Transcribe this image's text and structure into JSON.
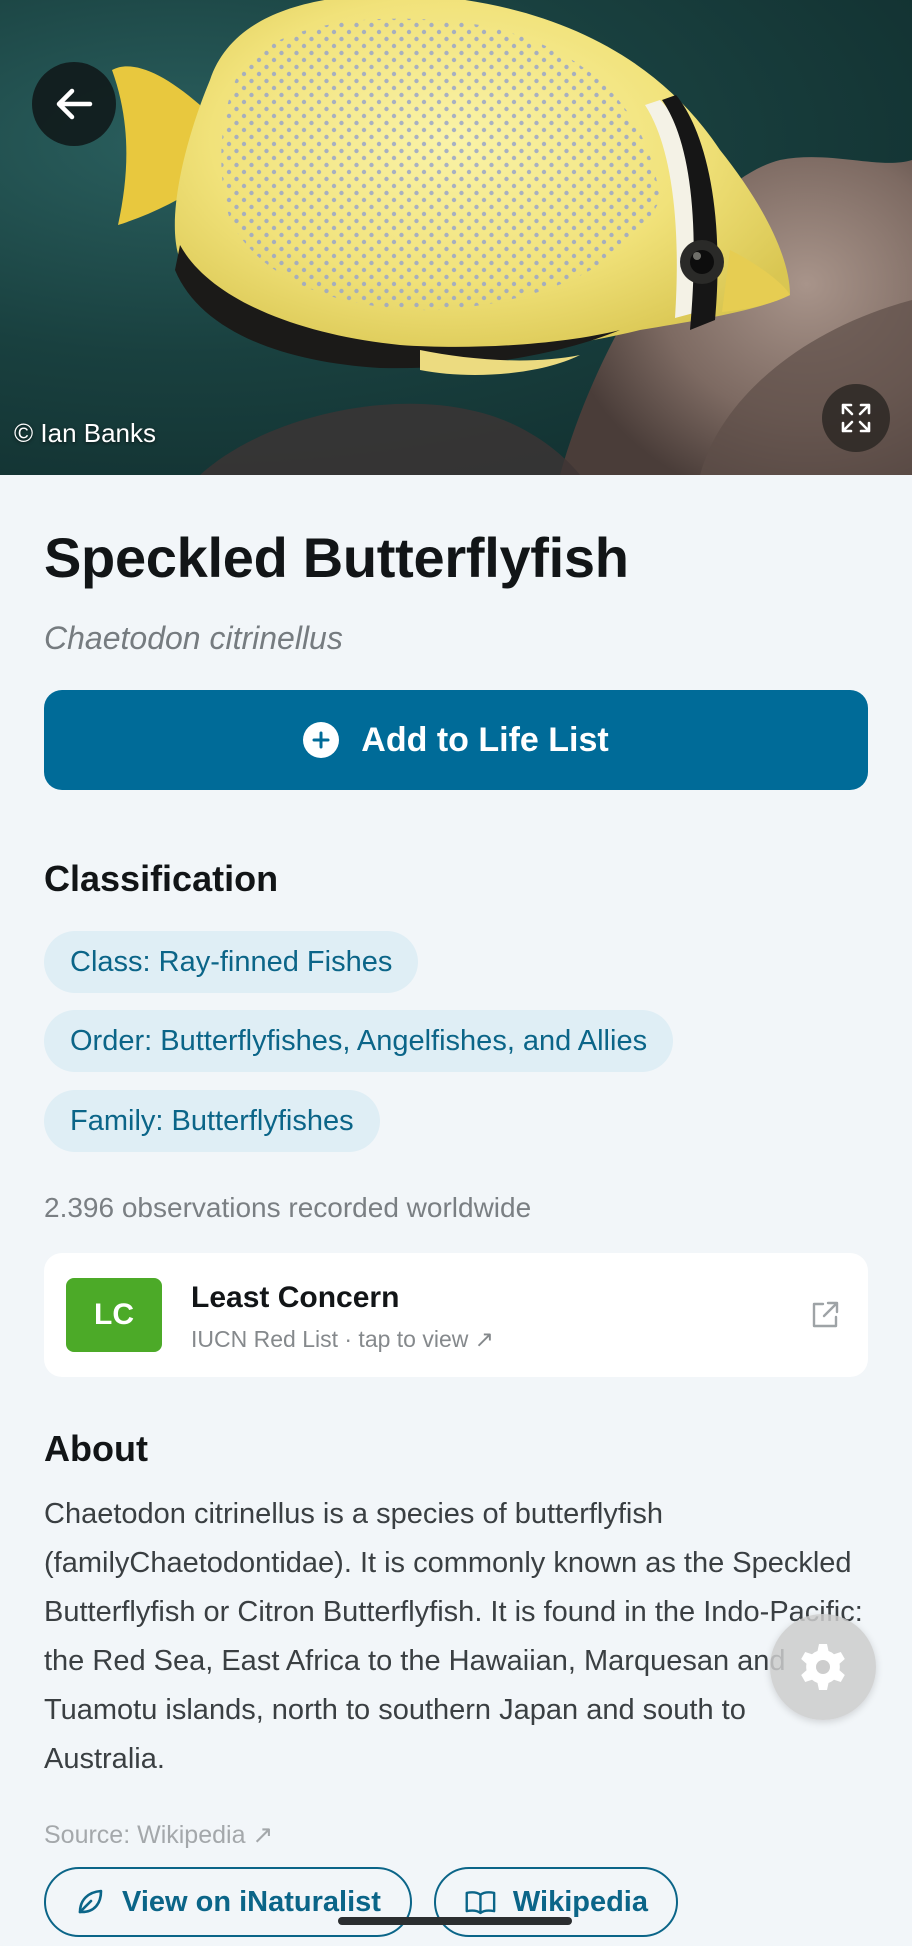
{
  "hero": {
    "credit": "© Ian Banks",
    "back_icon": "arrow-left-icon",
    "expand_icon": "expand-icon"
  },
  "species": {
    "common_name": "Speckled Butterflyfish",
    "scientific_name": "Chaetodon citrinellus"
  },
  "actions": {
    "add_life_list": "Add to Life List"
  },
  "classification": {
    "title": "Classification",
    "chips": [
      "Class: Ray-finned Fishes",
      "Order: Butterflyfishes, Angelfishes, and Allies",
      "Family: Butterflyfishes"
    ]
  },
  "observations": "2.396 observations recorded worldwide",
  "conservation": {
    "code": "LC",
    "status": "Least Concern",
    "subtitle": "IUCN Red List · tap to view ↗",
    "badge_color": "#4caa28"
  },
  "about": {
    "title": "About",
    "text": "Chaetodon citrinellus is a species of butterflyfish (familyChaetodontidae). It is commonly known as the Speckled Butterflyfish or Citron Butterflyfish. It is found in the Indo-Pacific: the Red Sea, East Africa to the Hawaiian, Marquesan and Tuamotu islands, north to southern Japan and south to Australia.",
    "source": "Source: Wikipedia ↗"
  },
  "links": {
    "inaturalist": "View on iNaturalist",
    "wikipedia": "Wikipedia"
  },
  "colors": {
    "primary": "#006b98",
    "chip_bg": "#dfeef5",
    "chip_text": "#0b6588",
    "background": "#f2f6f9"
  }
}
